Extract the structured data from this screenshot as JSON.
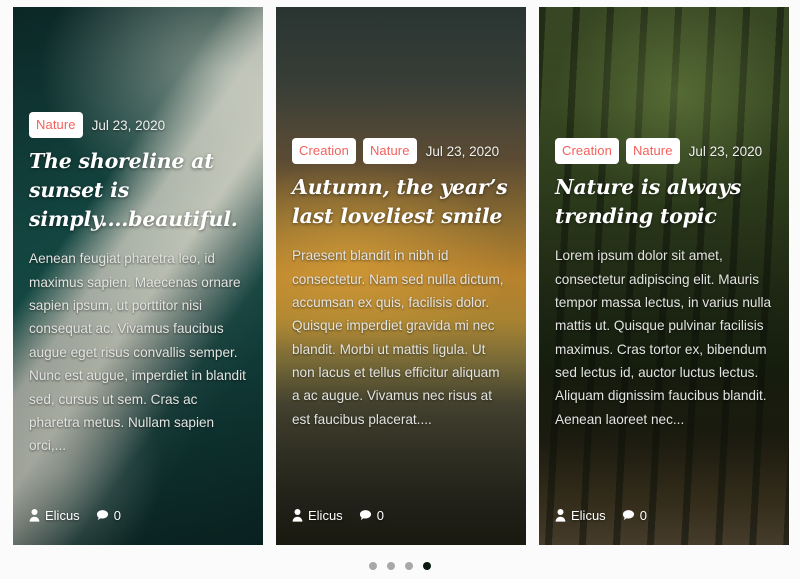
{
  "theme": {
    "page_background": "#fbfbfb",
    "tag_text_color": "#f4615c",
    "tag_background": "#ffffff",
    "title_color": "#ffffff",
    "excerpt_color": "#e3e4e1",
    "dot_color": "#a8a8a8",
    "dot_active_color": "#0a1a10"
  },
  "carousel": {
    "slides": [
      {
        "photo": "aerial-shoreline-teal-water",
        "tags": [
          "Nature"
        ],
        "date": "Jul 23, 2020",
        "title": "The shoreline at sunset is simply....beautiful.",
        "excerpt": "Aenean feugiat pharetra leo, id maximus sapien. Maecenas ornare sapien ipsum, ut porttitor nisi consequat ac. Vivamus faucibus augue eget risus convallis semper. Nunc est augue, imperdiet in blandit sed, cursus ut sem. Cras ac pharetra metus. Nullam sapien orci,...",
        "author": "Elicus",
        "comments": "0",
        "author_icon": "user-icon",
        "comment_icon": "comment-bubble-icon"
      },
      {
        "photo": "autumn-sunset-sky",
        "tags": [
          "Creation",
          "Nature"
        ],
        "date": "Jul 23, 2020",
        "title": "Autumn, the year’s last loveliest smile",
        "excerpt": "Praesent blandit in nibh id consectetur. Nam sed nulla dictum, accumsan ex quis, facilisis dolor. Quisque imperdiet gravida mi nec blandit. Morbi ut mattis ligula. Ut non lacus et tellus efficitur aliquam a ac augue. Vivamus nec risus at est faucibus placerat....",
        "author": "Elicus",
        "comments": "0",
        "author_icon": "user-icon",
        "comment_icon": "comment-bubble-icon"
      },
      {
        "photo": "green-forest-trees",
        "tags": [
          "Creation",
          "Nature"
        ],
        "date": "Jul 23, 2020",
        "title": "Nature is always trending topic",
        "excerpt": "Lorem ipsum dolor sit amet, consectetur adipiscing elit. Mauris tempor massa lectus, in varius nulla mattis ut. Quisque pulvinar facilisis maximus. Cras tortor ex, bibendum sed lectus id, auctor luctus lectus. Aliquam dignissim faucibus blandit. Aenean laoreet nec...",
        "author": "Elicus",
        "comments": "0",
        "author_icon": "user-icon",
        "comment_icon": "comment-bubble-icon"
      }
    ],
    "pagination": {
      "total": 4,
      "active_index": 3
    }
  }
}
